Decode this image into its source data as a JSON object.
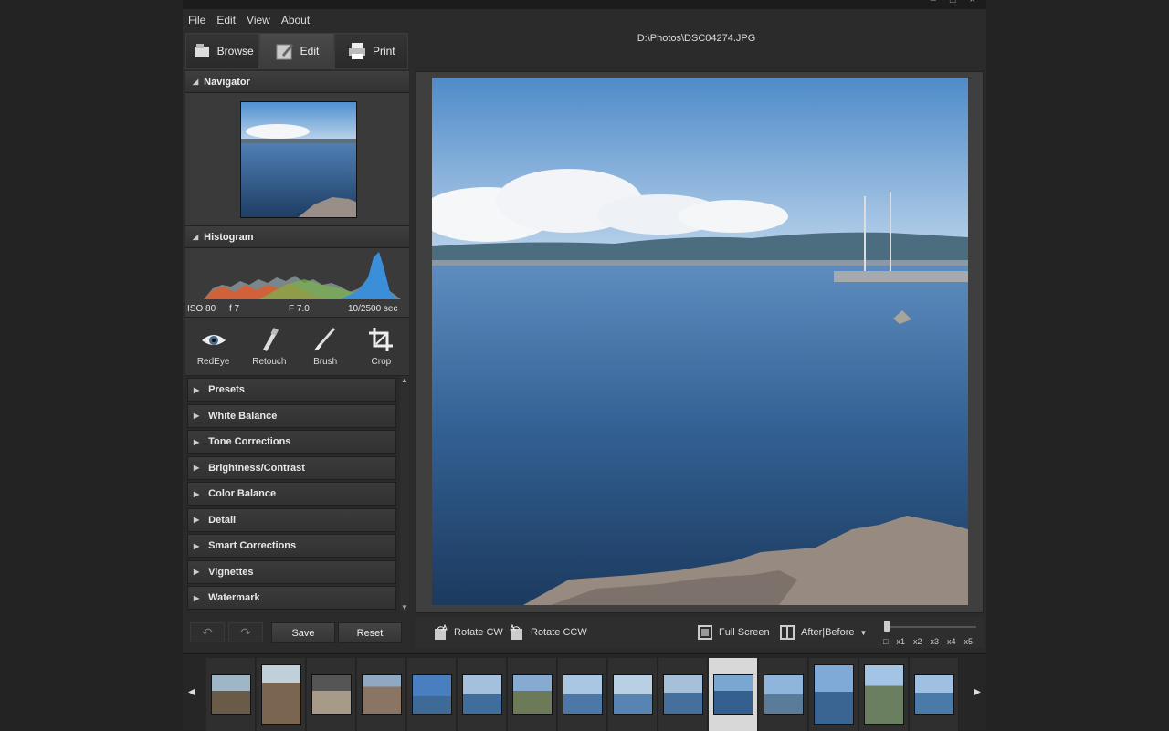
{
  "menu": {
    "file": "File",
    "edit": "Edit",
    "view": "View",
    "about": "About"
  },
  "modes": {
    "browse": "Browse",
    "edit": "Edit",
    "print": "Print"
  },
  "file_path": "D:\\Photos\\DSC04274.JPG",
  "panels": {
    "navigator": "Navigator",
    "histogram": "Histogram"
  },
  "exif": {
    "iso": "ISO 80",
    "focal": "f 7",
    "aperture": "F 7.0",
    "shutter": "10/2500 sec"
  },
  "tools": [
    {
      "label": "RedEye",
      "icon": "eye-icon"
    },
    {
      "label": "Retouch",
      "icon": "retouch-icon"
    },
    {
      "label": "Brush",
      "icon": "brush-icon"
    },
    {
      "label": "Crop",
      "icon": "crop-icon"
    }
  ],
  "adjustments": [
    "Presets",
    "White Balance",
    "Tone Corrections",
    "Brightness/Contrast",
    "Color Balance",
    "Detail",
    "Smart Corrections",
    "Vignettes",
    "Watermark"
  ],
  "buttons": {
    "save": "Save",
    "reset": "Reset"
  },
  "viewbar": {
    "rotate_cw": "Rotate CW",
    "rotate_ccw": "Rotate CCW",
    "full_screen": "Full Screen",
    "after_before": "After|Before"
  },
  "zoom_levels": [
    "x1",
    "x2",
    "x3",
    "x4",
    "x5"
  ],
  "colors": {
    "background": "#232323",
    "panel": "#2b2b2b",
    "sky": "#6fa0d0",
    "sea": "#2f5f92",
    "selected_thumb": "#d8d8d8"
  },
  "filmstrip": {
    "count": 15,
    "selected_index": 10
  }
}
